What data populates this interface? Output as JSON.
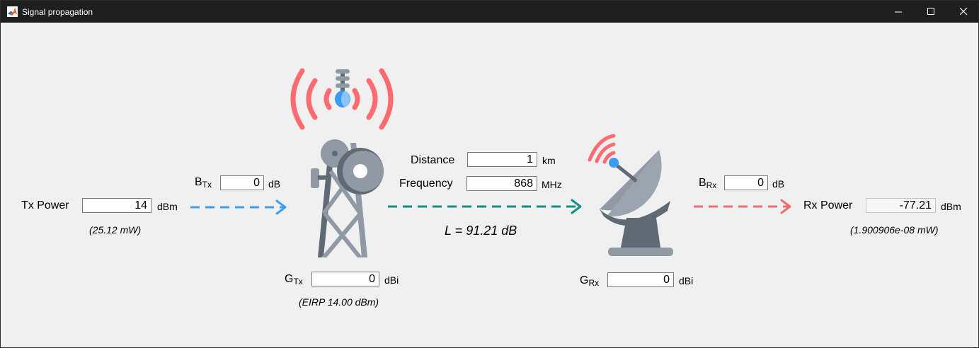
{
  "window": {
    "title": "Signal propagation",
    "controls": {
      "minimize": "minimize-icon",
      "maximize": "maximize-icon",
      "close": "close-icon"
    }
  },
  "tx": {
    "power_label": "Tx Power",
    "power_value": "14",
    "power_unit": "dBm",
    "power_mw": "(25.12 mW)",
    "b_label_main": "B",
    "b_label_sub": "Tx",
    "b_value": "0",
    "b_unit": "dB",
    "g_label_main": "G",
    "g_label_sub": "Tx",
    "g_value": "0",
    "g_unit": "dBi",
    "eirp": "(EIRP 14.00 dBm)"
  },
  "link": {
    "distance_label": "Distance",
    "distance_value": "1",
    "distance_unit": "km",
    "frequency_label": "Frequency",
    "frequency_value": "868",
    "frequency_unit": "MHz",
    "loss": "L = 91.21 dB"
  },
  "rx": {
    "b_label_main": "B",
    "b_label_sub": "Rx",
    "b_value": "0",
    "b_unit": "dB",
    "power_label": "Rx Power",
    "power_value": "-77.21",
    "power_unit": "dBm",
    "power_mw": "(1.900906e-08 mW)",
    "g_label_main": "G",
    "g_label_sub": "Rx",
    "g_value": "0",
    "g_unit": "dBi"
  },
  "colors": {
    "tx_arrow": "#3b9ff0",
    "path_arrow": "#119081",
    "rx_arrow": "#f56b6e",
    "wave": "#ff6b70",
    "metal_dark": "#5f6a74",
    "metal_light": "#8f9aa5",
    "accent_blue": "#3c9bf2"
  },
  "icons": {
    "tower": "cell-tower-icon",
    "dish": "satellite-dish-icon",
    "app": "matlab-logo-icon"
  }
}
